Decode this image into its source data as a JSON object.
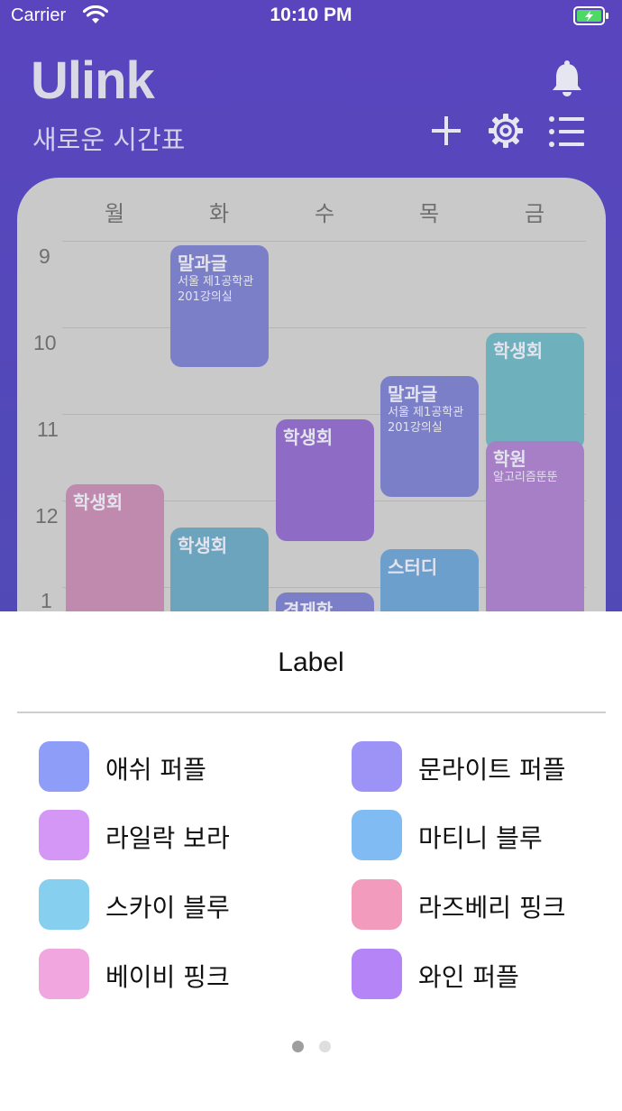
{
  "status_bar": {
    "carrier": "Carrier",
    "time": "10:10 PM"
  },
  "header": {
    "logo": "Ulink",
    "subtitle": "새로운 시간표"
  },
  "timetable": {
    "days": [
      "월",
      "화",
      "수",
      "목",
      "금"
    ],
    "hours": [
      "9",
      "10",
      "11",
      "12",
      "1"
    ],
    "courses": [
      {
        "name": "말과글",
        "info": "서울 제1공학관\n201강의실",
        "color": "#7b7fc8"
      },
      {
        "name": "학생회",
        "info": "",
        "color": "#6fb0bd"
      },
      {
        "name": "말과글",
        "info": "서울 제1공학관\n201강의실",
        "color": "#7b7fc8"
      },
      {
        "name": "학생회",
        "info": "",
        "color": "#8e6cc5"
      },
      {
        "name": "학원",
        "info": "알고리즘뚠뚠",
        "color": "#a77fc6"
      },
      {
        "name": "학생회",
        "info": "",
        "color": "#bf8aae"
      },
      {
        "name": "학생회",
        "info": "",
        "color": "#6ca3bd"
      },
      {
        "name": "스터디",
        "info": "",
        "color": "#6d9fcc"
      },
      {
        "name": "경제학",
        "info": "",
        "color": "#7b7fc8"
      }
    ]
  },
  "sheet": {
    "title": "Label",
    "labels": [
      {
        "name": "애쉬 퍼플",
        "color": "#8e9df8"
      },
      {
        "name": "문라이트 퍼플",
        "color": "#9d93f7"
      },
      {
        "name": "라일락 보라",
        "color": "#d597f5"
      },
      {
        "name": "마티니 블루",
        "color": "#80bcf3"
      },
      {
        "name": "스카이 블루",
        "color": "#86cfef"
      },
      {
        "name": "라즈베리 핑크",
        "color": "#f29bbd"
      },
      {
        "name": "베이비 핑크",
        "color": "#f2a6df"
      },
      {
        "name": "와인 퍼플",
        "color": "#b584f6"
      }
    ],
    "page_indicator": {
      "count": 2,
      "active": 0
    }
  },
  "colors": {
    "indicator_active": "#9e9e9e",
    "indicator_inactive": "#dedede"
  }
}
